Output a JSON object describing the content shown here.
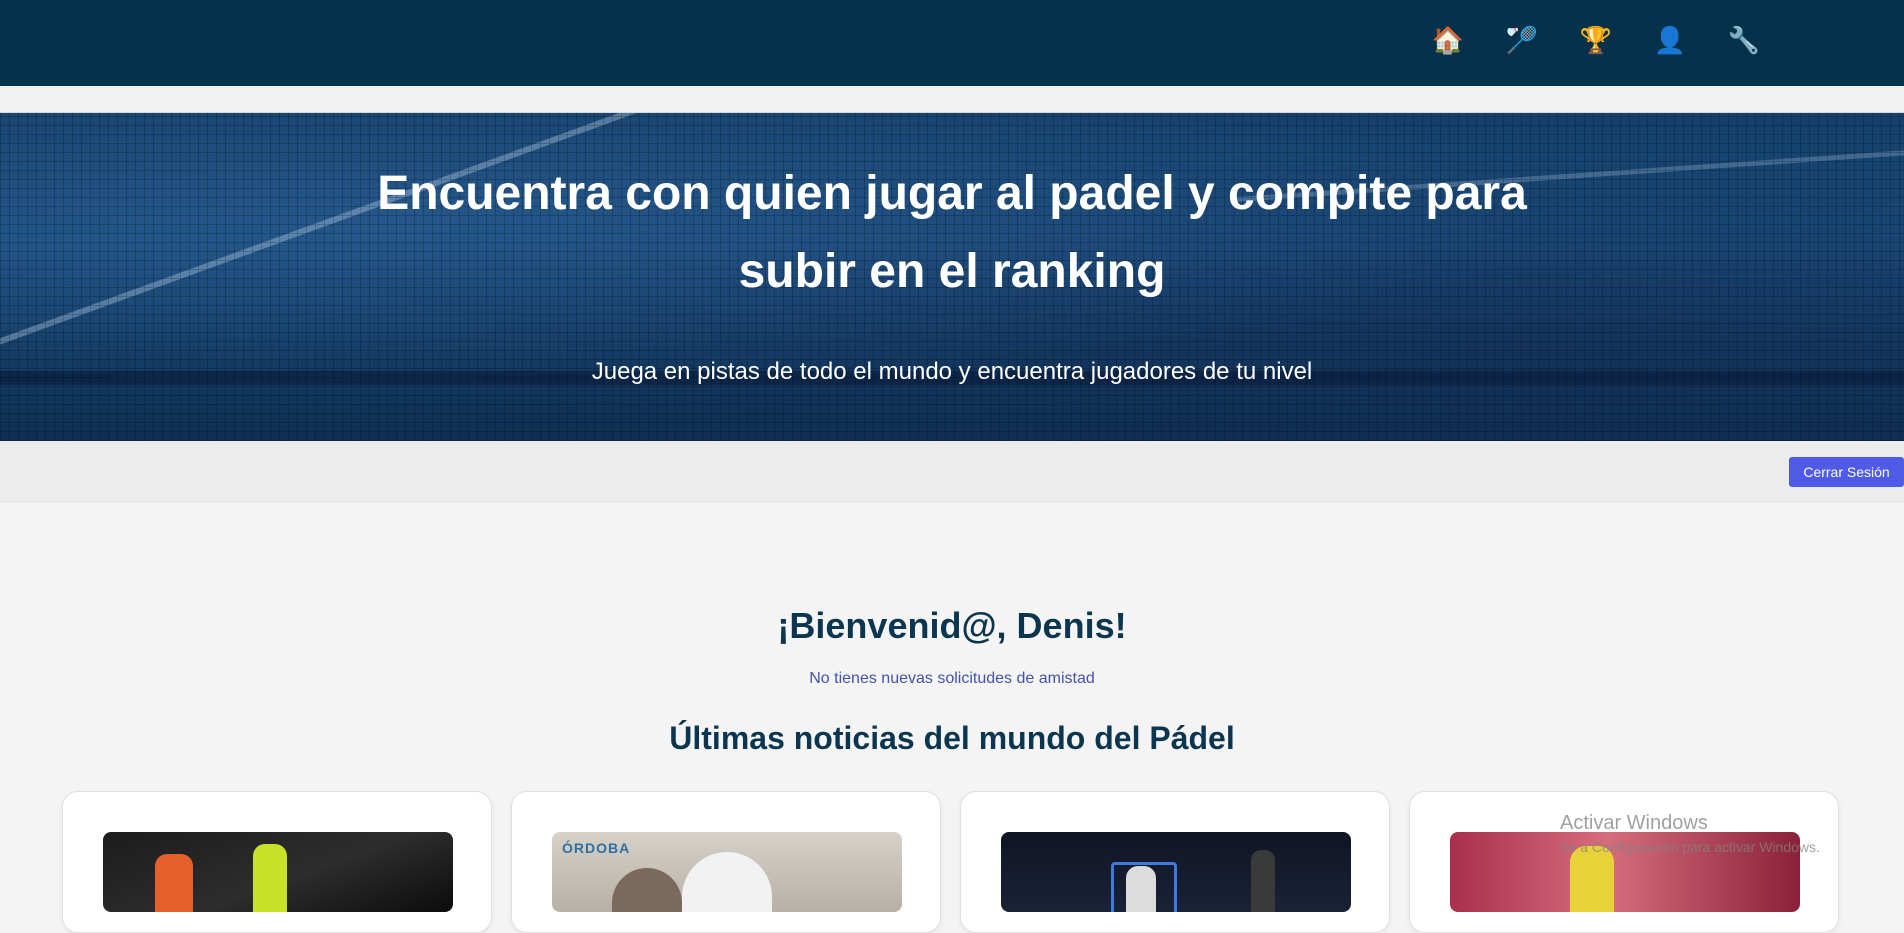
{
  "nav": {
    "items": [
      {
        "icon": "house-icon",
        "glyph": "🏠"
      },
      {
        "icon": "racket-icon",
        "glyph": "🏸"
      },
      {
        "icon": "trophy-icon",
        "glyph": "🏆"
      },
      {
        "icon": "user-icon",
        "glyph": "👤"
      },
      {
        "icon": "wrench-icon",
        "glyph": "🔧"
      }
    ]
  },
  "hero": {
    "title": "Encuentra con quien jugar al padel y compite para subir en el ranking",
    "subtitle": "Juega en pistas de todo el mundo y encuentra jugadores de tu nivel"
  },
  "session": {
    "logout_label": "Cerrar Sesión"
  },
  "main": {
    "welcome": "¡Bienvenid@, Denis!",
    "friend_requests": "No tienes nuevas solicitudes de amistad",
    "news_title": "Últimas noticias del mundo del Pádel",
    "news_cards": [
      {
        "sign": ""
      },
      {
        "sign": "ÓRDOBA"
      },
      {
        "sign": ""
      },
      {
        "sign": ""
      }
    ]
  },
  "windows_watermark": {
    "line1": "Activar Windows",
    "line2": "Ve a Configuración para activar Windows."
  },
  "colors": {
    "topbar": "#05314a",
    "accent": "#4f5be6",
    "heading": "#0c3650",
    "muted_link": "#4254a8"
  }
}
